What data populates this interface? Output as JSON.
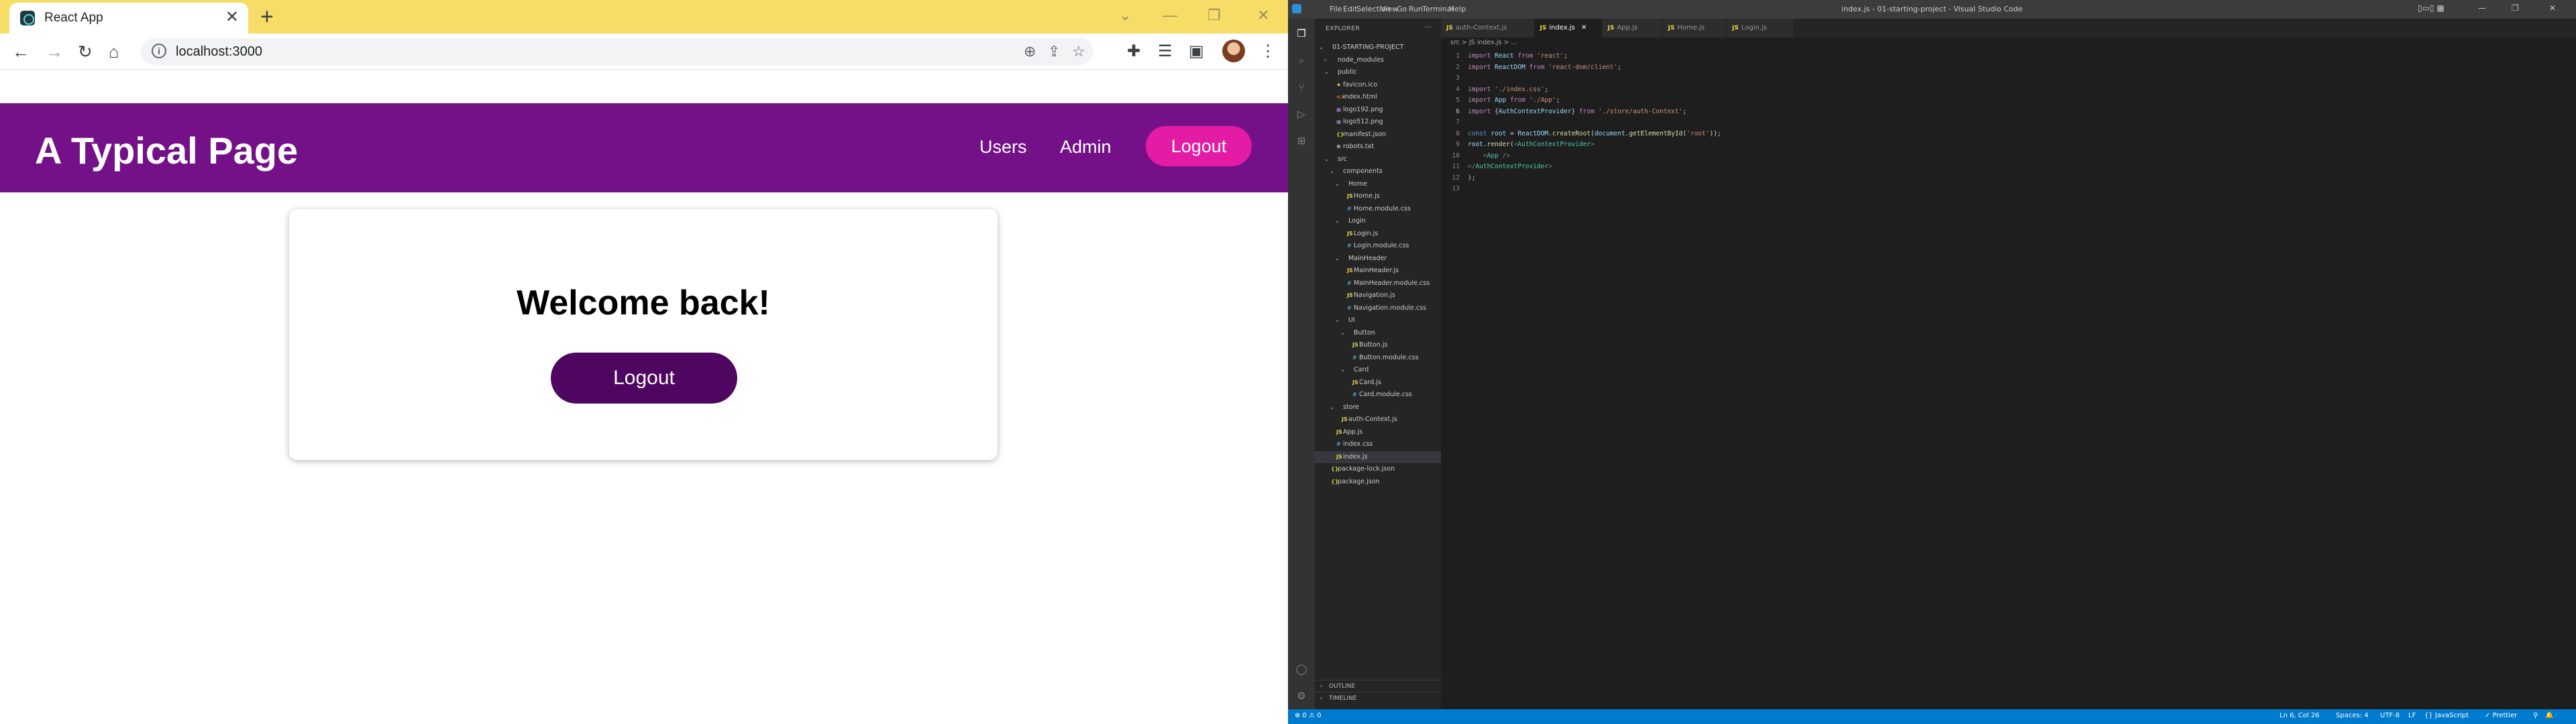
{
  "browser": {
    "tab_title": "React App",
    "tab_close": "✕",
    "new_tab": "+",
    "url": "localhost:3000",
    "window_controls": [
      "⌄",
      "—",
      "❐",
      "✕"
    ]
  },
  "app": {
    "title": "A Typical Page",
    "nav": [
      "Users",
      "Admin"
    ],
    "header_logout": "Logout",
    "welcome": "Welcome back!",
    "card_logout": "Logout"
  },
  "colors": {
    "header_purple": "#741188",
    "logout_pink": "#e31ba5",
    "card_button_purple": "#4f0660",
    "tabstrip_yellow": "#f8dc68",
    "vscode_status_blue": "#007acc"
  },
  "vscode": {
    "menu": [
      "File",
      "Edit",
      "Selection",
      "View",
      "Go",
      "Run",
      "Terminal",
      "Help"
    ],
    "window_title": "index.js - 01-starting-project - Visual Studio Code",
    "explorer_label": "EXPLORER",
    "tree": [
      {
        "label": "01-STARTING-PROJECT",
        "depth": 0,
        "kind": "folder-open"
      },
      {
        "label": "node_modules",
        "depth": 1,
        "kind": "folder"
      },
      {
        "label": "public",
        "depth": 1,
        "kind": "folder-open"
      },
      {
        "label": "favicon.ico",
        "depth": 2,
        "kind": "star"
      },
      {
        "label": "index.html",
        "depth": 2,
        "kind": "html"
      },
      {
        "label": "logo192.png",
        "depth": 2,
        "kind": "img"
      },
      {
        "label": "logo512.png",
        "depth": 2,
        "kind": "img"
      },
      {
        "label": "manifest.json",
        "depth": 2,
        "kind": "json"
      },
      {
        "label": "robots.txt",
        "depth": 2,
        "kind": "txt"
      },
      {
        "label": "src",
        "depth": 1,
        "kind": "folder-open"
      },
      {
        "label": "components",
        "depth": 2,
        "kind": "folder-open"
      },
      {
        "label": "Home",
        "depth": 3,
        "kind": "folder-open"
      },
      {
        "label": "Home.js",
        "depth": 4,
        "kind": "js"
      },
      {
        "label": "Home.module.css",
        "depth": 4,
        "kind": "css"
      },
      {
        "label": "Login",
        "depth": 3,
        "kind": "folder-open"
      },
      {
        "label": "Login.js",
        "depth": 4,
        "kind": "js"
      },
      {
        "label": "Login.module.css",
        "depth": 4,
        "kind": "css"
      },
      {
        "label": "MainHeader",
        "depth": 3,
        "kind": "folder-open"
      },
      {
        "label": "MainHeader.js",
        "depth": 4,
        "kind": "js"
      },
      {
        "label": "MainHeader.module.css",
        "depth": 4,
        "kind": "css"
      },
      {
        "label": "Navigation.js",
        "depth": 4,
        "kind": "js"
      },
      {
        "label": "Navigation.module.css",
        "depth": 4,
        "kind": "css"
      },
      {
        "label": "UI",
        "depth": 3,
        "kind": "folder-open"
      },
      {
        "label": "Button",
        "depth": 4,
        "kind": "folder-open"
      },
      {
        "label": "Button.js",
        "depth": 5,
        "kind": "js"
      },
      {
        "label": "Button.module.css",
        "depth": 5,
        "kind": "css"
      },
      {
        "label": "Card",
        "depth": 4,
        "kind": "folder-open"
      },
      {
        "label": "Card.js",
        "depth": 5,
        "kind": "js"
      },
      {
        "label": "Card.module.css",
        "depth": 5,
        "kind": "css"
      },
      {
        "label": "store",
        "depth": 2,
        "kind": "folder-open"
      },
      {
        "label": "auth-Context.js",
        "depth": 3,
        "kind": "js"
      },
      {
        "label": "App.js",
        "depth": 2,
        "kind": "js"
      },
      {
        "label": "index.css",
        "depth": 2,
        "kind": "css"
      },
      {
        "label": "index.js",
        "depth": 2,
        "kind": "js",
        "selected": true
      },
      {
        "label": "package-lock.json",
        "depth": 1,
        "kind": "json"
      },
      {
        "label": "package.json",
        "depth": 1,
        "kind": "json"
      }
    ],
    "panels": [
      "OUTLINE",
      "TIMELINE"
    ],
    "tabs": [
      {
        "label": "auth-Context.js",
        "active": false
      },
      {
        "label": "index.js",
        "active": true
      },
      {
        "label": "App.js",
        "active": false
      },
      {
        "label": "Home.js",
        "active": false
      },
      {
        "label": "Login.js",
        "active": false
      }
    ],
    "breadcrumb": "src > JS index.js > ...",
    "code": [
      [
        [
          "kw",
          "import "
        ],
        [
          "id",
          "React "
        ],
        [
          "kw",
          "from "
        ],
        [
          "str",
          "'react'"
        ],
        [
          "pl",
          ";"
        ]
      ],
      [
        [
          "kw",
          "import "
        ],
        [
          "id",
          "ReactDOM "
        ],
        [
          "kw",
          "from "
        ],
        [
          "str",
          "'react-dom/client'"
        ],
        [
          "pl",
          ";"
        ]
      ],
      [],
      [
        [
          "kw",
          "import "
        ],
        [
          "str",
          "'./index.css'"
        ],
        [
          "pl",
          ";"
        ]
      ],
      [
        [
          "kw",
          "import "
        ],
        [
          "id",
          "App "
        ],
        [
          "kw",
          "from "
        ],
        [
          "str",
          "'./App'"
        ],
        [
          "pl",
          ";"
        ]
      ],
      [
        [
          "kw",
          "import "
        ],
        [
          "pl",
          "{"
        ],
        [
          "id",
          "AuthContextProvider"
        ],
        [
          "pl",
          "} "
        ],
        [
          "kw",
          "from "
        ],
        [
          "str",
          "'./store/auth-Context'"
        ],
        [
          "pl",
          ";"
        ]
      ],
      [],
      [
        [
          "dk",
          "const "
        ],
        [
          "id",
          "root "
        ],
        [
          "pl",
          "= "
        ],
        [
          "id",
          "ReactDOM"
        ],
        [
          "pl",
          "."
        ],
        [
          "fn",
          "createRoot"
        ],
        [
          "pl",
          "("
        ],
        [
          "id",
          "document"
        ],
        [
          "pl",
          "."
        ],
        [
          "fn",
          "getElementById"
        ],
        [
          "pl",
          "("
        ],
        [
          "str",
          "'root'"
        ],
        [
          "pl",
          "));"
        ]
      ],
      [
        [
          "id",
          "root"
        ],
        [
          "pl",
          "."
        ],
        [
          "fn",
          "render"
        ],
        [
          "pl",
          "("
        ],
        [
          "tag",
          "<"
        ],
        [
          "cls",
          "AuthContextProvider"
        ],
        [
          "tag",
          ">"
        ]
      ],
      [
        [
          "pl",
          "    "
        ],
        [
          "tag",
          "<"
        ],
        [
          "cls",
          "App "
        ],
        [
          "tag",
          "/>"
        ]
      ],
      [
        [
          "tag",
          "</"
        ],
        [
          "cls",
          "AuthContextProvider"
        ],
        [
          "tag",
          ">"
        ]
      ],
      [
        [
          "pl",
          ");"
        ]
      ],
      []
    ],
    "current_line": 6,
    "status_left": "⊗ 0 ⚠ 0",
    "status_right": [
      "Ln 6, Col 26",
      "Spaces: 4",
      "UTF-8",
      "LF",
      "{} JavaScript",
      "✓ Prettier",
      "⚲",
      "🔔"
    ]
  }
}
